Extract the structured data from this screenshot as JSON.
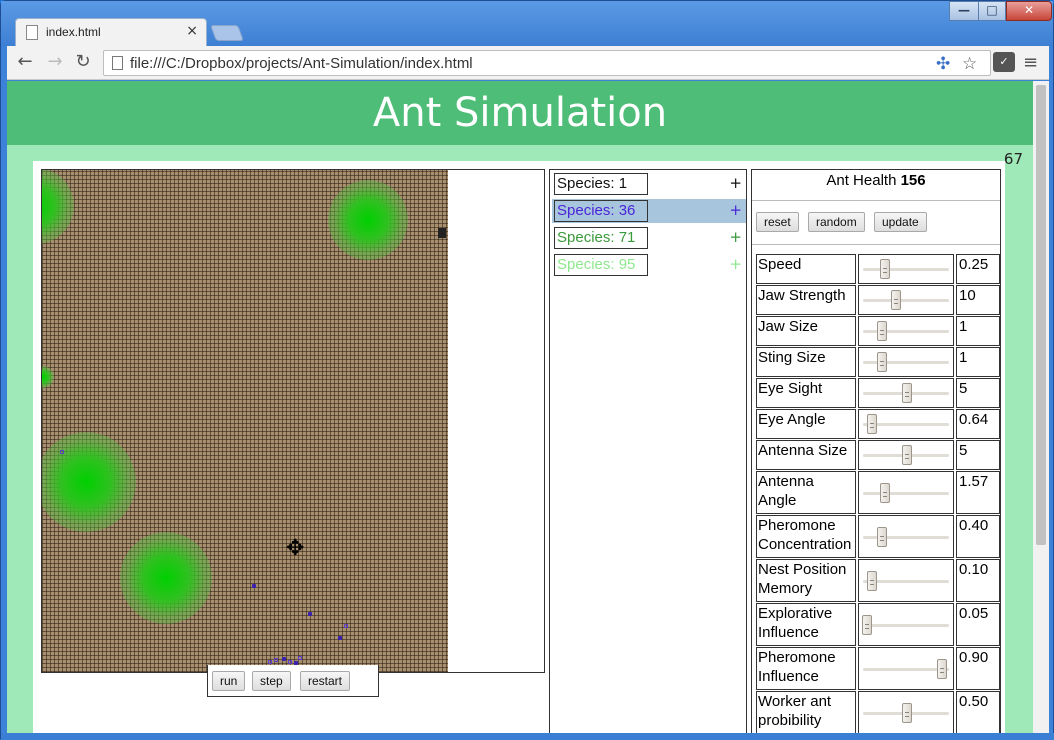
{
  "browser": {
    "tab_title": "index.html",
    "tab_close": "×",
    "url": "file:///C:/Dropbox/projects/Ant-Simulation/index.html",
    "back_icon": "←",
    "forward_icon": "→",
    "reload_icon": "↻",
    "star_icon": "☆",
    "menu_icon": "≡",
    "min_icon": "—",
    "max_icon": "□",
    "close_icon": "✕"
  },
  "page": {
    "title": "Ant Simulation",
    "counter": "67"
  },
  "controls": {
    "run": "run",
    "step": "step",
    "restart": "restart"
  },
  "species": [
    {
      "label": "Species: 1",
      "plus": "+",
      "color": "#111111",
      "selected": false
    },
    {
      "label": "Species: 36",
      "plus": "+",
      "color": "#4a25d8",
      "selected": true
    },
    {
      "label": "Species: 71",
      "plus": "+",
      "color": "#3a9a3a",
      "selected": false
    },
    {
      "label": "Species: 95",
      "plus": "+",
      "color": "#8ee88e",
      "selected": false
    }
  ],
  "settings": {
    "health_label": "Ant Health",
    "health_value": "156",
    "reset": "reset",
    "random": "random",
    "update": "update",
    "params": [
      {
        "name": "Speed",
        "value": "0.25",
        "level": 0.25
      },
      {
        "name": "Jaw Strength",
        "value": "10",
        "level": 0.38
      },
      {
        "name": "Jaw Size",
        "value": "1",
        "level": 0.22
      },
      {
        "name": "Sting Size",
        "value": "1",
        "level": 0.22
      },
      {
        "name": "Eye Sight",
        "value": "5",
        "level": 0.5
      },
      {
        "name": "Eye Angle",
        "value": "0.64",
        "level": 0.1
      },
      {
        "name": "Antenna Size",
        "value": "5",
        "level": 0.5
      },
      {
        "name": "Antenna Angle",
        "value": "1.57",
        "level": 0.25
      },
      {
        "name": "Pheromone Concentration",
        "value": "0.40",
        "level": 0.22
      },
      {
        "name": "Nest Position Memory",
        "value": "0.10",
        "level": 0.1
      },
      {
        "name": "Explorative Influence",
        "value": "0.05",
        "level": 0.05
      },
      {
        "name": "Pheromone Influence",
        "value": "0.90",
        "level": 0.9
      },
      {
        "name": "Worker ant probibility",
        "value": "0.50",
        "level": 0.5
      }
    ]
  }
}
